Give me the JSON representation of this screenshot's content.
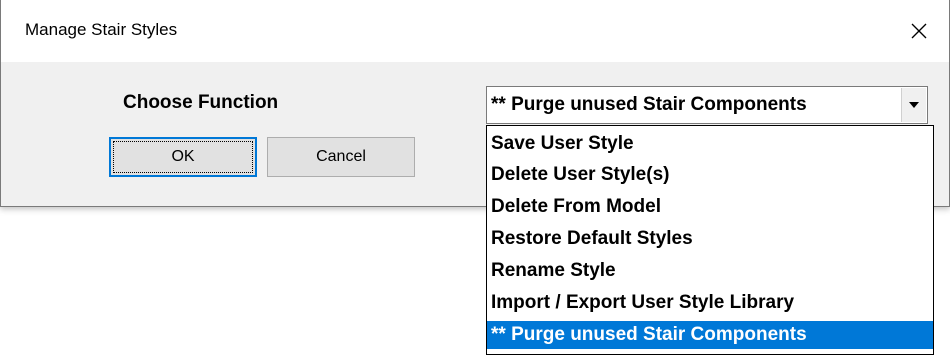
{
  "window": {
    "title": "Manage Stair Styles",
    "close_label": "×"
  },
  "form": {
    "choose_label": "Choose Function",
    "combo_value": "** Purge unused Stair Components",
    "options": [
      "Save User Style",
      "Delete User Style(s)",
      "Delete From Model",
      "Restore Default Styles",
      "Rename Style",
      "Import / Export User Style Library",
      "** Purge unused Stair Components"
    ],
    "selected_index": 6
  },
  "buttons": {
    "ok_label": "OK",
    "cancel_label": "Cancel"
  },
  "colors": {
    "selection_bg": "#0078d7",
    "dialog_bg": "#f0f0f0",
    "titlebar_bg": "#ffffff"
  },
  "icons": {
    "close": "close-icon",
    "dropdown": "chevron-down-icon"
  }
}
